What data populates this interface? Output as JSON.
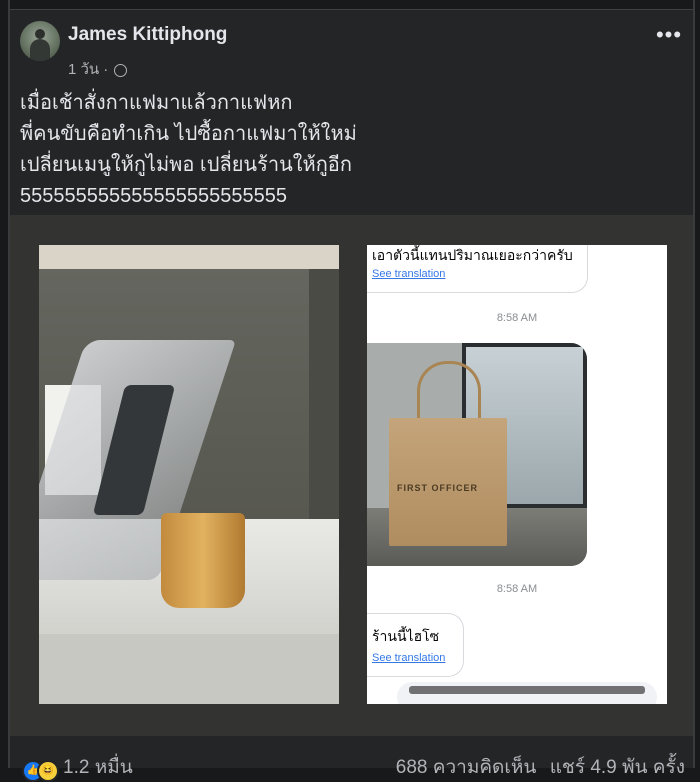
{
  "post": {
    "author": "James Kittiphong",
    "time": "1 วัน",
    "separator": "·",
    "text_lines": [
      "เมื่อเช้าสั่งกาแฟมาแล้วกาแฟหก",
      "พี่คนขับคือทำเกิน ไปซื้อกาแฟมาให้ใหม่",
      "เปลี่ยนเมนูให้กูไม่พอ เปลี่ยนร้านให้กูอีก",
      "555555555555555555555555"
    ]
  },
  "chat": {
    "message1": "เอาตัวนี้แทนปริมาณเยอะกว่าครับ",
    "see_translation": "See translation",
    "time1": "8:58 AM",
    "time2": "8:58 AM",
    "bag_logo": "FIRST OFFICER",
    "message2": "ร้านนี้ไฮโซ"
  },
  "footer": {
    "reactions": "1.2 หมื่น",
    "comments": "688 ความคิดเห็น",
    "shares": "แชร์ 4.9 พัน ครั้ง"
  },
  "icons": {
    "more": "more-options-icon",
    "globe": "globe-icon",
    "like": "like-reaction-icon",
    "haha": "haha-reaction-icon"
  },
  "colors": {
    "background": "#18191a",
    "card": "#242526",
    "text": "#e4e6eb",
    "secondary_text": "#b0b3b8",
    "link_blue": "#3578e5",
    "like_blue": "#1877f2"
  }
}
